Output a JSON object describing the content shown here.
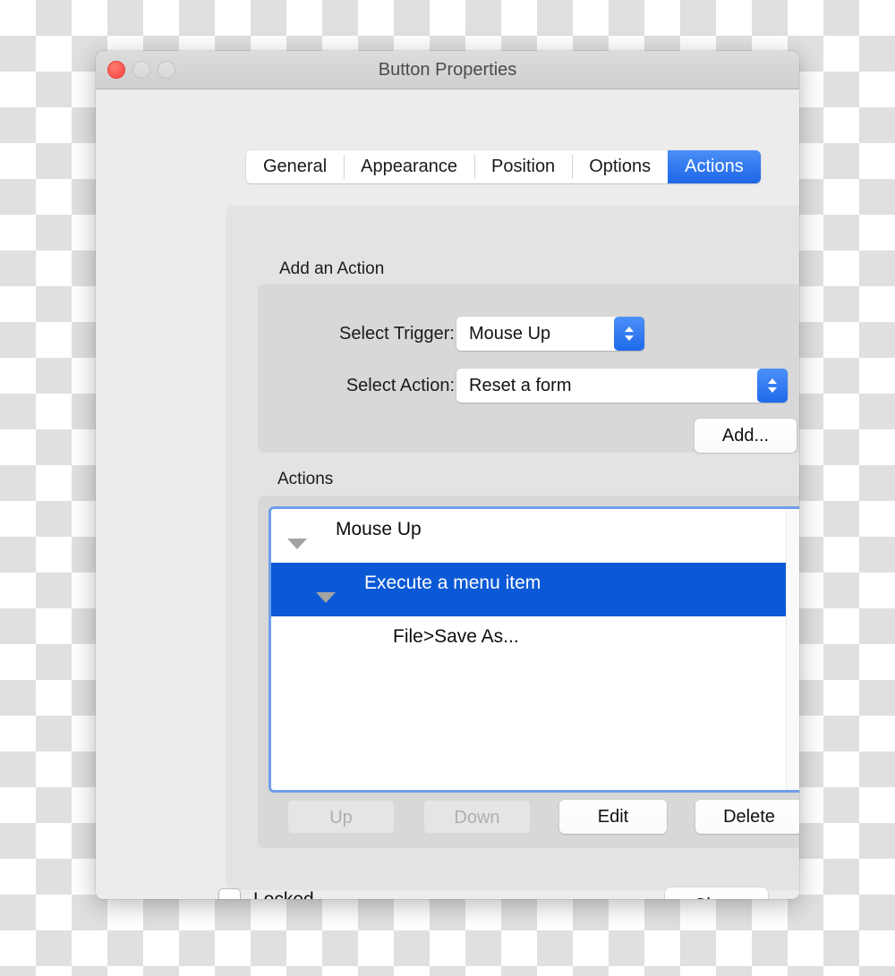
{
  "window": {
    "title": "Button Properties",
    "traffic_lights": [
      {
        "name": "close",
        "state": "active"
      },
      {
        "name": "minimize",
        "state": "disabled"
      },
      {
        "name": "zoom",
        "state": "disabled"
      }
    ]
  },
  "tabs": [
    {
      "label": "General",
      "active": false
    },
    {
      "label": "Appearance",
      "active": false
    },
    {
      "label": "Position",
      "active": false
    },
    {
      "label": "Options",
      "active": false
    },
    {
      "label": "Actions",
      "active": true
    }
  ],
  "add_action": {
    "group_label": "Add an Action",
    "trigger_label": "Select Trigger:",
    "trigger_value": "Mouse Up",
    "action_label": "Select Action:",
    "action_value": "Reset a form",
    "add_button": "Add..."
  },
  "actions": {
    "group_label": "Actions",
    "tree": [
      {
        "label": "Mouse Up",
        "level": 0,
        "has_disclosure": true,
        "selected": false
      },
      {
        "label": "Execute a menu item",
        "level": 1,
        "has_disclosure": true,
        "selected": true
      },
      {
        "label": "File>Save As...",
        "level": 2,
        "has_disclosure": false,
        "selected": false
      }
    ],
    "buttons": [
      {
        "label": "Up",
        "enabled": false
      },
      {
        "label": "Down",
        "enabled": false
      },
      {
        "label": "Edit",
        "enabled": true
      },
      {
        "label": "Delete",
        "enabled": true
      }
    ]
  },
  "footer": {
    "locked_label": "Locked",
    "locked_checked": false,
    "close_label": "Close"
  },
  "colors": {
    "accent_blue": "#1d6aea",
    "selection_blue": "#0b59d6",
    "focus_ring": "#6f9eea",
    "window_bg": "#ececec",
    "panel_bg": "#e3e3e3",
    "group_bg": "#d8d8d8",
    "close_red": "#fb5b52"
  }
}
